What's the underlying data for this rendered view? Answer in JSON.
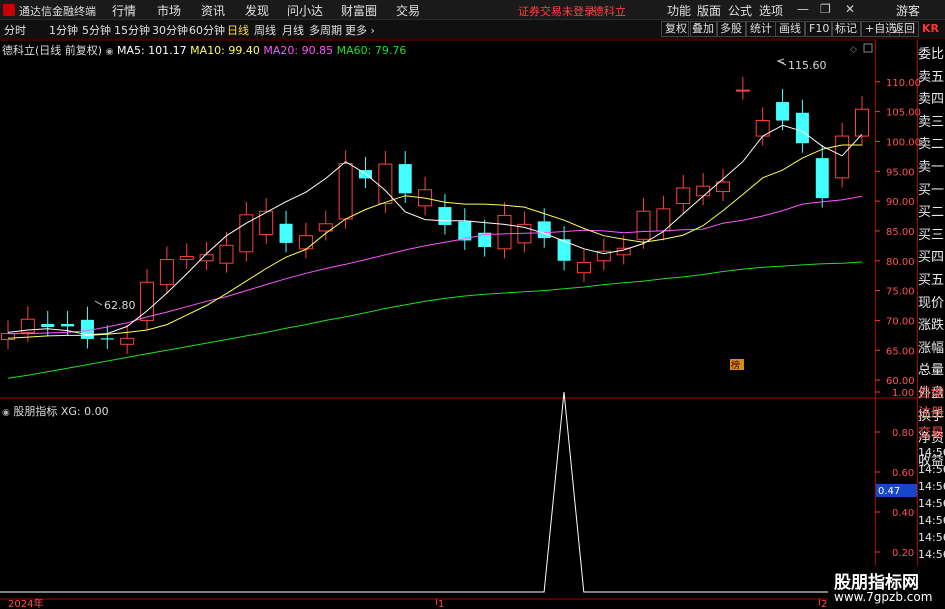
{
  "app": {
    "name": "通达信金融终端"
  },
  "menu": [
    "行情",
    "市场",
    "资讯",
    "发现",
    "问小达",
    "财富圈",
    "交易"
  ],
  "warning": "证券交易未登录",
  "stock_name_top": "德科立",
  "right_menu": [
    "功能",
    "版面",
    "公式",
    "选项"
  ],
  "user": "游客",
  "window_controls": [
    "—",
    "❐",
    "✕"
  ],
  "periods": [
    "分时",
    "1分钟",
    "5分钟",
    "15分钟",
    "30分钟",
    "60分钟",
    "日线",
    "周线",
    "月线",
    "多周期",
    "更多 ›"
  ],
  "active_period": "日线",
  "tools": [
    "复权",
    "叠加",
    "多股",
    "统计",
    "画线",
    "F10",
    "标记",
    "+自选",
    "返回"
  ],
  "main": {
    "title": "德科立(日线 前复权)",
    "ma5": "MA5: 101.17",
    "ma10": "MA10: 99.40",
    "ma20": "MA20: 90.85",
    "ma60": "MA60: 79.76",
    "high_label": "115.60",
    "low_label": "62.80",
    "badge": "榜"
  },
  "sub": {
    "title": "股朋指标",
    "xg": "XG: 0.00",
    "cursor_value": "0.47"
  },
  "colors": {
    "ma5": "#ffffff",
    "ma10": "#ffff5a",
    "ma20": "#ff55ff",
    "ma60": "#22dd22",
    "up": "#ff4040",
    "down": "#44ffff",
    "grid": "#7a0000",
    "axis": "#ff3030"
  },
  "price_axis": [
    "110.00",
    "105.00",
    "100.00",
    "95.00",
    "90.00",
    "85.00",
    "80.00",
    "75.00",
    "70.00",
    "65.00",
    "60.00"
  ],
  "sub_axis": [
    "1.00",
    "0.80",
    "0.60",
    "0.40",
    "0.20"
  ],
  "x_axis": [
    "2024年",
    "1",
    "2"
  ],
  "side_panel": [
    "委比",
    "卖五",
    "卖四",
    "卖三",
    "卖二",
    "卖一",
    "买一",
    "买二",
    "买三",
    "买四",
    "买五",
    "现价",
    "涨跌",
    "涨幅",
    "总量",
    "外盘",
    "换手",
    "净资",
    "收益"
  ],
  "side_panel_sub": [
    "自动",
    "注册",
    "交易",
    "14:56",
    "14:56",
    "14:56",
    "14:56",
    "14:56",
    "14:56",
    "14:56",
    "14:56",
    "14:56"
  ],
  "corner": "KR",
  "watermark": {
    "line1": "股朋指标网",
    "line2": "www.7gpzb.com"
  },
  "chart_data": {
    "type": "candlestick",
    "y_range": [
      57,
      117
    ],
    "candles": [
      {
        "o": 66.8,
        "c": 67.8
      },
      {
        "o": 68.0,
        "c": 70.2
      },
      {
        "o": 69.4,
        "c": 68.9
      },
      {
        "o": 69.4,
        "c": 69.0
      },
      {
        "o": 70.1,
        "c": 66.9
      },
      {
        "o": 67.0,
        "c": 66.8
      },
      {
        "o": 66.0,
        "c": 67.0
      },
      {
        "o": 70.0,
        "c": 76.4
      },
      {
        "o": 76.0,
        "c": 80.2
      },
      {
        "o": 80.2,
        "c": 80.7
      },
      {
        "o": 80.0,
        "c": 81.0
      },
      {
        "o": 79.6,
        "c": 82.6
      },
      {
        "o": 81.5,
        "c": 87.7
      },
      {
        "o": 84.4,
        "c": 88.3
      },
      {
        "o": 86.2,
        "c": 83.0
      },
      {
        "o": 82.0,
        "c": 84.2
      },
      {
        "o": 85.0,
        "c": 86.2
      },
      {
        "o": 87.0,
        "c": 96.3
      },
      {
        "o": 95.2,
        "c": 93.8
      },
      {
        "o": 89.6,
        "c": 96.2
      },
      {
        "o": 96.2,
        "c": 91.3
      },
      {
        "o": 89.2,
        "c": 91.9
      },
      {
        "o": 89.0,
        "c": 86.0
      },
      {
        "o": 86.6,
        "c": 83.4
      },
      {
        "o": 84.7,
        "c": 82.3
      },
      {
        "o": 82.0,
        "c": 87.6
      },
      {
        "o": 83.0,
        "c": 86.1
      },
      {
        "o": 86.6,
        "c": 83.8
      },
      {
        "o": 83.6,
        "c": 80.0
      },
      {
        "o": 78.0,
        "c": 79.7
      },
      {
        "o": 80.0,
        "c": 81.6
      },
      {
        "o": 81.0,
        "c": 82.1
      },
      {
        "o": 83.6,
        "c": 88.3
      },
      {
        "o": 85.0,
        "c": 88.7
      },
      {
        "o": 89.6,
        "c": 92.2
      },
      {
        "o": 90.9,
        "c": 92.5
      },
      {
        "o": 91.6,
        "c": 93.2
      },
      {
        "o": 108.6,
        "c": 108.6
      },
      {
        "o": 100.9,
        "c": 103.5
      },
      {
        "o": 106.6,
        "c": 103.5
      },
      {
        "o": 104.8,
        "c": 99.7
      },
      {
        "o": 97.2,
        "c": 90.5
      },
      {
        "o": 93.9,
        "c": 100.9
      },
      {
        "o": 100.9,
        "c": 105.4
      }
    ],
    "ma5": [
      68,
      68.4,
      68.6,
      68.3,
      67.6,
      67.8,
      69,
      71.6,
      74.6,
      77.8,
      81.2,
      84.2,
      86.3,
      88.1,
      89.9,
      91.5,
      93.8,
      96.6,
      94.6,
      91.8,
      88.2,
      86.9,
      86.7,
      86.7,
      86.4,
      86.1,
      85.6,
      84.6,
      83.3,
      82.0,
      81.2,
      81.8,
      82.9,
      84.9,
      87.9,
      90.8,
      93.7,
      96.6,
      100.9,
      102.7,
      101.7,
      99.2,
      97.6,
      101.2
    ],
    "ma10": [
      67,
      67.2,
      67.4,
      67.5,
      67.5,
      67.7,
      68.0,
      68.4,
      69.3,
      70.9,
      72.5,
      74.5,
      76.6,
      78.7,
      80.6,
      81.9,
      84.6,
      87.0,
      88.6,
      89.8,
      90.9,
      90.5,
      89.8,
      89.5,
      89.5,
      89.3,
      89.0,
      87.9,
      86.8,
      85.4,
      84.2,
      83.6,
      83.1,
      83.6,
      84.3,
      85.9,
      88.4,
      91.1,
      93.9,
      95.2,
      97.2,
      98.7,
      99.4,
      99.4
    ],
    "ma20": [
      67.8,
      67.8,
      67.9,
      68,
      68.3,
      68.9,
      69.6,
      70.6,
      71.4,
      72.3,
      73.2,
      74.0,
      75.0,
      76.0,
      77.0,
      77.9,
      78.7,
      79.4,
      80.2,
      81.0,
      81.8,
      82.5,
      83.1,
      83.7,
      84.4,
      84.5,
      84.6,
      84.7,
      84.9,
      85.1,
      85.0,
      84.7,
      84.9,
      85.0,
      85.2,
      85.3,
      86.3,
      86.8,
      87.5,
      88.4,
      89.5,
      89.9,
      90.2,
      90.8
    ],
    "ma60": [
      60.3,
      60.8,
      61.4,
      62.0,
      62.6,
      63.2,
      63.8,
      64.4,
      65.0,
      65.6,
      66.2,
      66.8,
      67.4,
      68.0,
      68.7,
      69.3,
      70.0,
      70.6,
      71.3,
      72.0,
      72.6,
      73.2,
      73.7,
      74.1,
      74.4,
      74.6,
      74.8,
      75.0,
      75.3,
      75.6,
      76.0,
      76.3,
      76.6,
      77.0,
      77.3,
      77.7,
      78.2,
      78.6,
      78.9,
      79.1,
      79.3,
      79.5,
      79.6,
      79.8
    ],
    "sub_series": {
      "name": "XG",
      "x_index": [
        0,
        28,
        29,
        30,
        44
      ],
      "values": [
        0,
        0,
        1,
        0,
        0
      ],
      "y_range": [
        0,
        1.0
      ]
    }
  }
}
